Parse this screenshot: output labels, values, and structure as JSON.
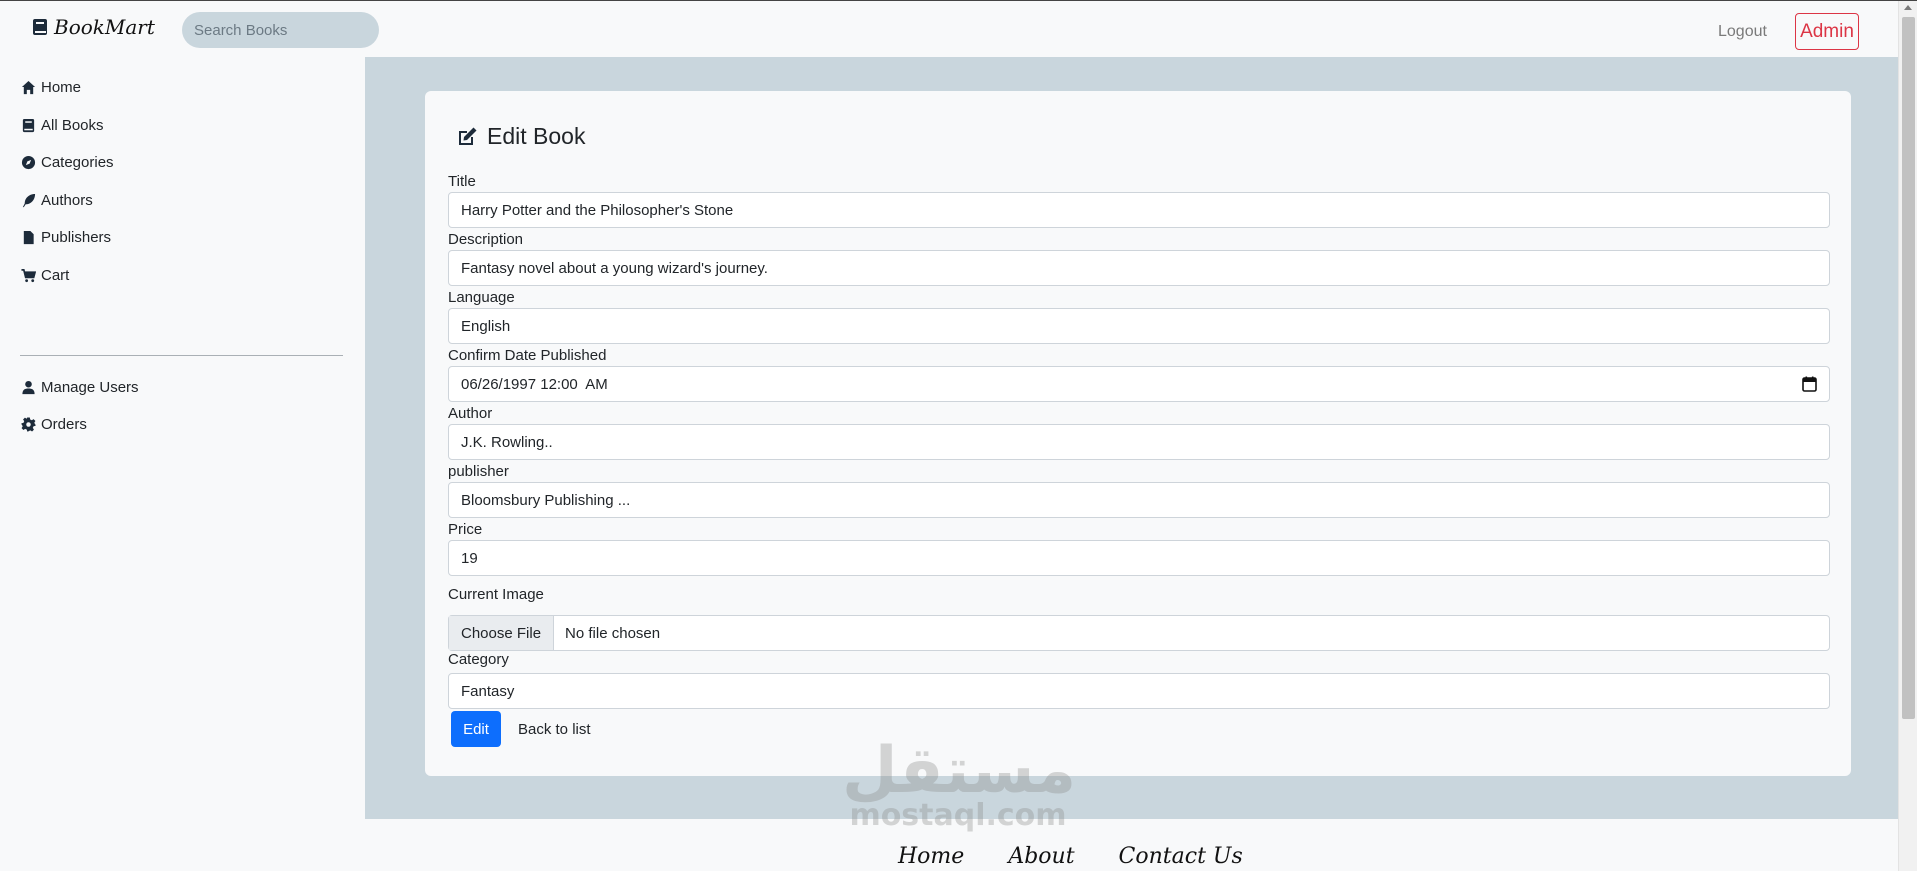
{
  "nav": {
    "brand": "BookMart",
    "search_placeholder": "Search Books",
    "logout": "Logout",
    "admin": "Admin"
  },
  "sidebar": {
    "items": [
      {
        "label": "Home",
        "icon": "home-icon"
      },
      {
        "label": "All Books",
        "icon": "book-icon"
      },
      {
        "label": "Categories",
        "icon": "compass-icon"
      },
      {
        "label": "Authors",
        "icon": "feather-icon"
      },
      {
        "label": "Publishers",
        "icon": "file-icon"
      },
      {
        "label": "Cart",
        "icon": "cart-icon"
      }
    ],
    "admin_items": [
      {
        "label": "Manage Users",
        "icon": "user-icon"
      },
      {
        "label": "Orders",
        "icon": "gear-icon"
      }
    ]
  },
  "form": {
    "heading": "Edit Book",
    "fields": {
      "title": {
        "label": "Title",
        "value": "Harry Potter and the Philosopher's Stone"
      },
      "description": {
        "label": "Description",
        "value": "Fantasy novel about a young wizard's journey."
      },
      "language": {
        "label": "Language",
        "value": "English"
      },
      "date": {
        "label": "Confirm Date Published",
        "value": "06/26/1997 12:00  AM"
      },
      "author": {
        "label": "Author",
        "value": "J.K. Rowling.."
      },
      "publisher": {
        "label": "publisher",
        "value": "Bloomsbury Publishing ..."
      },
      "price": {
        "label": "Price",
        "value": "19"
      },
      "image": {
        "label": "Current Image",
        "button": "Choose File",
        "status": "No file chosen"
      },
      "category": {
        "label": "Category",
        "value": "Fantasy"
      }
    },
    "submit": "Edit",
    "back": "Back to list"
  },
  "footer": {
    "links": [
      "Home",
      "About",
      "Contact Us"
    ]
  },
  "watermark": {
    "arabic": "مستقل",
    "latin": "mostaql.com"
  }
}
